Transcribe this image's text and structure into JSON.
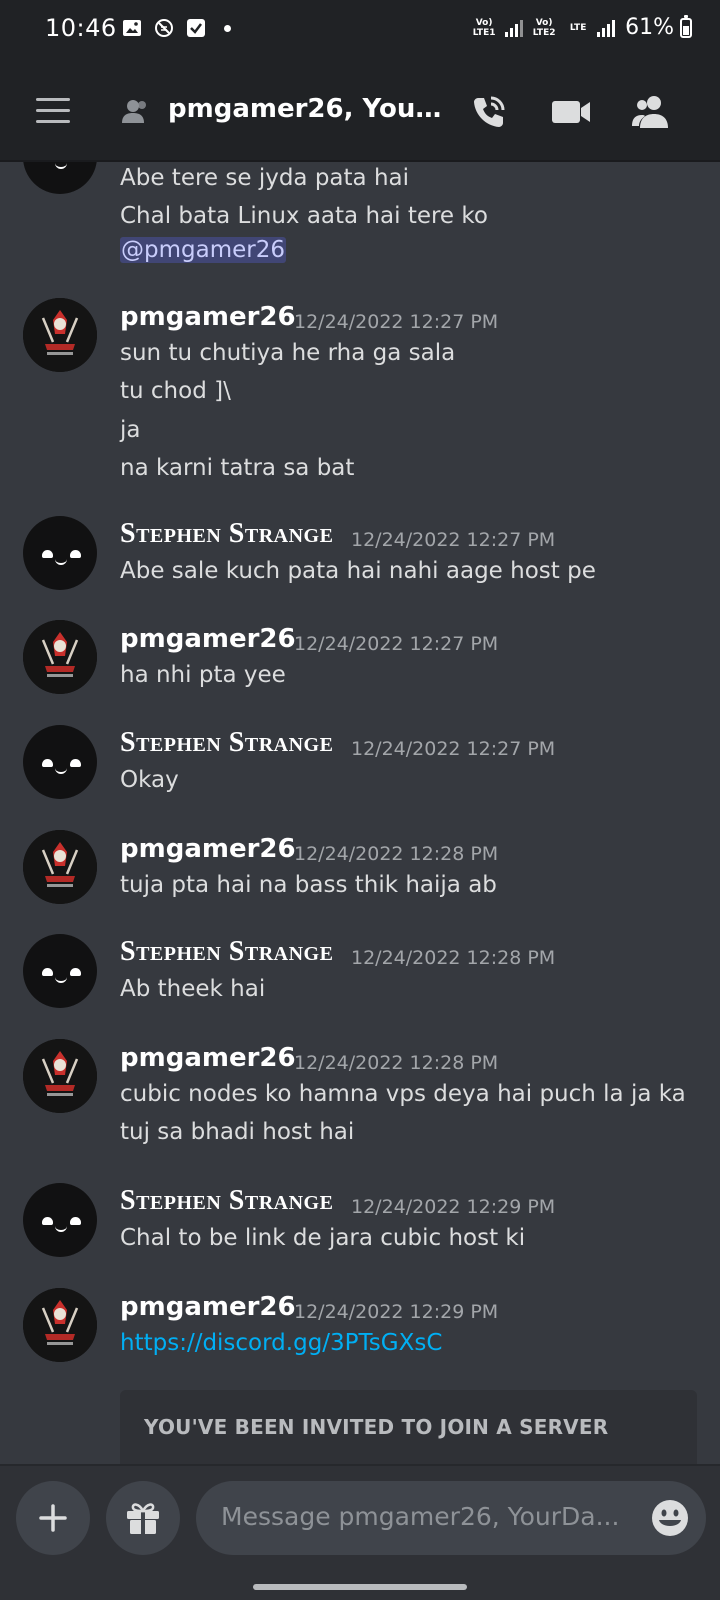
{
  "status_bar": {
    "time": "10:46",
    "sim1_label": "Vo) LTE1",
    "sim2_label": "Vo) LTE2",
    "data_label": "LTE",
    "battery": "61%"
  },
  "header": {
    "title": "pmgamer26, YourD..."
  },
  "messages": [
    {
      "author": "",
      "timestamp": "",
      "lines": [
        "Abe tere se jyda pata hai",
        "Chal bata Linux aata hai tere ko"
      ],
      "mention": "@pmgamer26",
      "avatar": "smiley-avatar"
    },
    {
      "author": "pmgamer26",
      "timestamp": "12/24/2022 12:27 PM",
      "lines": [
        "sun tu chutiya he rha ga sala",
        "tu chod ]\\",
        "ja",
        "na karni tatra sa bat"
      ],
      "avatar": "pm-gamer-avatar"
    },
    {
      "author": "Stephen Strange",
      "timestamp": "12/24/2022 12:27 PM",
      "lines": [
        "Abe sale kuch pata hai nahi aage host pe"
      ],
      "avatar": "smiley-avatar"
    },
    {
      "author": "pmgamer26",
      "timestamp": "12/24/2022 12:27 PM",
      "lines": [
        "ha nhi pta yee"
      ],
      "avatar": "pm-gamer-avatar"
    },
    {
      "author": "Stephen Strange",
      "timestamp": "12/24/2022 12:27 PM",
      "lines": [
        "Okay"
      ],
      "avatar": "smiley-avatar"
    },
    {
      "author": "pmgamer26",
      "timestamp": "12/24/2022 12:28 PM",
      "lines": [
        "tuja pta hai na bass thik haija ab"
      ],
      "avatar": "pm-gamer-avatar"
    },
    {
      "author": "Stephen Strange",
      "timestamp": "12/24/2022 12:28 PM",
      "lines": [
        "Ab theek hai"
      ],
      "avatar": "smiley-avatar"
    },
    {
      "author": "pmgamer26",
      "timestamp": "12/24/2022 12:28 PM",
      "lines": [
        "cubic nodes ko hamna vps deya hai puch la ja ka",
        "tuj sa bhadi host hai"
      ],
      "avatar": "pm-gamer-avatar"
    },
    {
      "author": "Stephen Strange",
      "timestamp": "12/24/2022 12:29 PM",
      "lines": [
        "Chal to be link de jara cubic host ki"
      ],
      "avatar": "smiley-avatar"
    },
    {
      "author": "pmgamer26",
      "timestamp": "12/24/2022 12:29 PM",
      "link": "https://discord.gg/3PTsGXsC",
      "avatar": "pm-gamer-avatar"
    }
  ],
  "invite_card": {
    "title": "YOU'VE BEEN INVITED TO JOIN A SERVER"
  },
  "composer": {
    "placeholder": "Message pmgamer26, YourDa..."
  },
  "colors": {
    "background": "#36393f",
    "header": "#202225",
    "link": "#00aff4",
    "mention_bg": "#414675"
  }
}
